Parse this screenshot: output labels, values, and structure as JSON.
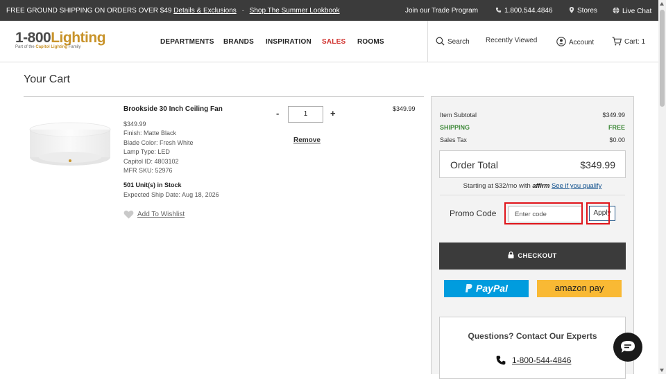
{
  "topbar": {
    "promo_text": "FREE GROUND SHIPPING ON ORDERS OVER $49",
    "details_link": "Details & Exclusions",
    "separator": "·",
    "lookbook_link": "Shop The Summer Lookbook",
    "trade_link": "Join our Trade Program",
    "phone": "1.800.544.4846",
    "stores": "Stores",
    "live_chat": "Live Chat"
  },
  "header": {
    "logo_main_a": "1-800",
    "logo_main_b": "Lighting",
    "logo_tag_a": "Part of the",
    "logo_tag_b": "Capitol Lighting",
    "logo_tag_c": "Family",
    "nav": [
      "DEPARTMENTS",
      "BRANDS",
      "INSPIRATION",
      "SALES",
      "ROOMS"
    ],
    "search": "Search",
    "recently_viewed": "Recently Viewed",
    "account": "Account",
    "cart": "Cart: 1"
  },
  "page_title": "Your Cart",
  "cart_item": {
    "name": "Brookside 30 Inch Ceiling Fan",
    "price": "$349.99",
    "details": [
      "Finish: Matte Black",
      "Blade Color: Fresh White",
      "Lamp Type: LED",
      "Capitol ID: 4803102",
      "MFR SKU: 52976"
    ],
    "stock": "501 Unit(s) in Stock",
    "ship_date": "Expected Ship Date: Aug 18, 2026",
    "wishlist": "Add To Wishlist",
    "qty_minus": "-",
    "qty": "1",
    "qty_plus": "+",
    "remove": "Remove",
    "line_total": "$349.99"
  },
  "summary": {
    "subtotal_label": "Item Subtotal",
    "subtotal_value": "$349.99",
    "shipping_label": "SHIPPING",
    "shipping_value": "FREE",
    "tax_label": "Sales Tax",
    "tax_value": "$0.00",
    "total_label": "Order Total",
    "total_value": "$349.99",
    "affirm_text": "Starting at $32/mo with",
    "affirm_logo": "affirm",
    "affirm_link": "See if you qualify",
    "promo_label": "Promo Code",
    "promo_placeholder": "Enter code",
    "apply": "Apply",
    "checkout": "CHECKOUT",
    "paypal": "PayPal",
    "amazon": "amazon pay",
    "questions_title": "Questions? Contact Our Experts",
    "questions_phone": "1-800-544-4846"
  },
  "colors": {
    "topbar_bg": "#3b3b3b",
    "sales_red": "#d0312d",
    "brand_gold": "#c8932a",
    "shipping_green": "#3f8a3a",
    "highlight_red": "#e0141a",
    "paypal_blue": "#009cde",
    "amazon_yellow": "#f9b934"
  }
}
